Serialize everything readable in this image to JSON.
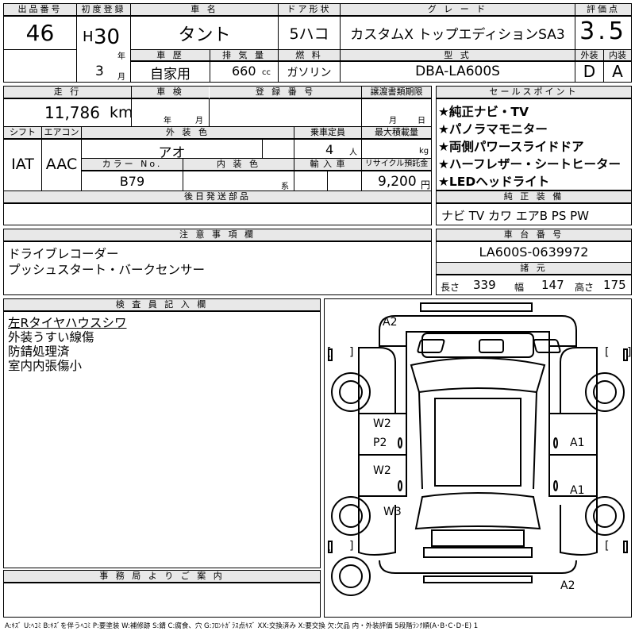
{
  "header": {
    "lot_label": "出品番号",
    "lot_value": "46",
    "first_reg_label": "初度登録",
    "era_prefix": "H",
    "year": "30",
    "year_unit": "年",
    "month": "3",
    "month_unit": "月",
    "car_name_label": "車 名",
    "car_name": "タント",
    "door_label": "ドア形状",
    "door": "5ハコ",
    "grade_label": "グ レ ー ド",
    "grade": "カスタムX トップエディションSA3",
    "score_label": "評価点",
    "score": "3.5",
    "history_label": "車 歴",
    "history": "自家用",
    "disp_label": "排 気 量",
    "disp": "660",
    "disp_unit": "cc",
    "fuel_label": "燃 料",
    "fuel": "ガソリン",
    "model_label": "型 式",
    "model": "DBA-LA600S",
    "ext_grade_label": "外装",
    "ext_grade": "D",
    "int_grade_label": "内装",
    "int_grade": "A"
  },
  "row2": {
    "mileage_label": "走 行",
    "mileage": "11,786",
    "mileage_unit": "km",
    "inspection_label": "車 検",
    "insp_year_unit": "年",
    "insp_month_unit": "月",
    "reg_no_label": "登 録 番 号",
    "transfer_label": "譲渡書類期限",
    "transfer_month_unit": "月",
    "transfer_day_unit": "日",
    "shift_label": "シフト",
    "shift": "IAT",
    "ac_label": "エアコン",
    "ac": "AAC",
    "ext_color_label": "外 装 色",
    "ext_color": "アオ",
    "capacity_label": "乗車定員",
    "capacity": "4",
    "capacity_unit": "人",
    "max_load_label": "最大積載量",
    "max_load_unit": "kg",
    "color_no_label": "カラー No.",
    "color_no": "B79",
    "int_color_label": "内 装 色",
    "int_color_unit": "系",
    "import_label": "輸 入 車",
    "recycle_label": "リサイクル預託金",
    "recycle": "9,200",
    "recycle_unit": "円"
  },
  "sales_points": {
    "label": "セールスポイント",
    "items": [
      "★純正ナビ・TV",
      "★パノラマモニター",
      "★両側パワースライドドア",
      "★ハーフレザー・シートヒーター",
      "★LEDヘッドライト"
    ]
  },
  "later_parts": {
    "label": "後日発送部品"
  },
  "genuine": {
    "label": "純 正 装 備",
    "value": "ナビ TV カワ エアB PS PW"
  },
  "notes": {
    "label": "注 意 事 項 欄",
    "lines": [
      "ドライブレコーダー",
      "プッシュスタート・バークセンサー"
    ]
  },
  "chassis": {
    "label": "車 台 番 号",
    "value": "LA600S-0639972"
  },
  "specs": {
    "label": "諸 元",
    "length_label": "長さ",
    "length": "339",
    "width_label": "幅",
    "width": "147",
    "height_label": "高さ",
    "height": "175"
  },
  "inspector": {
    "label": "検 査 員 記 入 欄",
    "lines": [
      "左Rタイヤハウスシワ",
      "外装うすい線傷",
      "防錆処理済",
      "室内内張傷小"
    ]
  },
  "office": {
    "label": "事 務 局 よ り ご 案 内"
  },
  "diagram": {
    "marks": {
      "a2_top": "A2",
      "w2_a": "W2",
      "p2": "P2",
      "w2_b": "W2",
      "w3": "W3",
      "a1_a": "A1",
      "a1_b": "A1",
      "a2_bottom": "A2"
    },
    "bracket_open": "[",
    "bracket_close": "]"
  },
  "legend": "A:ｷｽﾞ U:ﾍｺﾐ B:ｷｽﾞを伴うﾍｺﾐ P:要塗装 W:補修跡 S:錆 C:腐食、穴 G:ﾌﾛﾝﾄｶﾞﾗｽ点ｷｽﾞ XX:交換済み X:要交換 欠:欠品 内・外装評価 5段階ﾗﾝｸ順(A･B･C･D･E) 1"
}
